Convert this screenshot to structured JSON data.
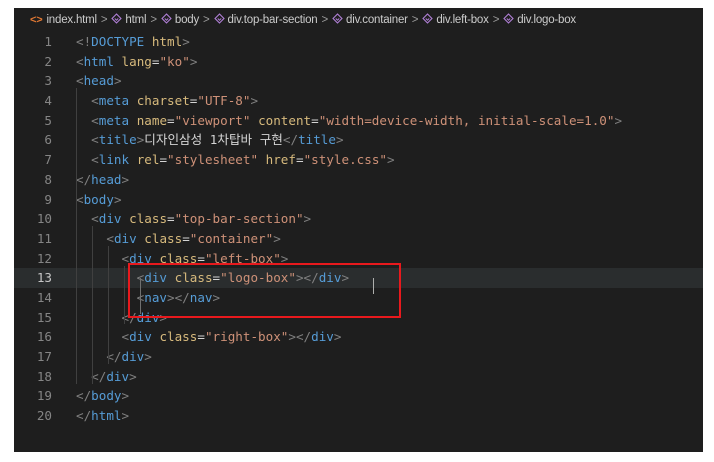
{
  "breadcrumb": {
    "items": [
      {
        "label": "index.html",
        "icon": "html-file-icon"
      },
      {
        "label": "html",
        "icon": "element-icon"
      },
      {
        "label": "body",
        "icon": "element-icon"
      },
      {
        "label": "div.top-bar-section",
        "icon": "element-icon"
      },
      {
        "label": "div.container",
        "icon": "element-icon"
      },
      {
        "label": "div.left-box",
        "icon": "element-icon"
      },
      {
        "label": "div.logo-box",
        "icon": "element-icon"
      }
    ],
    "separator": ">"
  },
  "code_lines": [
    {
      "n": "1",
      "parts": [
        [
          "t",
          "<!"
        ],
        [
          "tn",
          "DOCTYPE"
        ],
        [
          "tx",
          " "
        ],
        [
          "an",
          "html"
        ],
        [
          "t",
          ">"
        ]
      ]
    },
    {
      "n": "2",
      "parts": [
        [
          "t",
          "<"
        ],
        [
          "tn",
          "html"
        ],
        [
          "tx",
          " "
        ],
        [
          "an",
          "lang"
        ],
        [
          "tx",
          "="
        ],
        [
          "av",
          "\"ko\""
        ],
        [
          "t",
          ">"
        ]
      ]
    },
    {
      "n": "3",
      "parts": [
        [
          "t",
          "<"
        ],
        [
          "tn",
          "head"
        ],
        [
          "t",
          ">"
        ]
      ]
    },
    {
      "n": "4",
      "parts": [
        [
          "tx",
          "  "
        ],
        [
          "t",
          "<"
        ],
        [
          "tn",
          "meta"
        ],
        [
          "tx",
          " "
        ],
        [
          "an",
          "charset"
        ],
        [
          "tx",
          "="
        ],
        [
          "av",
          "\"UTF-8\""
        ],
        [
          "t",
          ">"
        ]
      ]
    },
    {
      "n": "5",
      "parts": [
        [
          "tx",
          "  "
        ],
        [
          "t",
          "<"
        ],
        [
          "tn",
          "meta"
        ],
        [
          "tx",
          " "
        ],
        [
          "an",
          "name"
        ],
        [
          "tx",
          "="
        ],
        [
          "av",
          "\"viewport\""
        ],
        [
          "tx",
          " "
        ],
        [
          "an",
          "content"
        ],
        [
          "tx",
          "="
        ],
        [
          "av",
          "\"width=device-width, initial-scale=1.0\""
        ],
        [
          "t",
          ">"
        ]
      ]
    },
    {
      "n": "6",
      "parts": [
        [
          "tx",
          "  "
        ],
        [
          "t",
          "<"
        ],
        [
          "tn",
          "title"
        ],
        [
          "t",
          ">"
        ],
        [
          "tx",
          "디자인삼성 1차탑바 구현"
        ],
        [
          "t",
          "</"
        ],
        [
          "tn",
          "title"
        ],
        [
          "t",
          ">"
        ]
      ]
    },
    {
      "n": "7",
      "parts": [
        [
          "tx",
          "  "
        ],
        [
          "t",
          "<"
        ],
        [
          "tn",
          "link"
        ],
        [
          "tx",
          " "
        ],
        [
          "an",
          "rel"
        ],
        [
          "tx",
          "="
        ],
        [
          "av",
          "\"stylesheet\""
        ],
        [
          "tx",
          " "
        ],
        [
          "an",
          "href"
        ],
        [
          "tx",
          "="
        ],
        [
          "av",
          "\"style.css\""
        ],
        [
          "t",
          ">"
        ]
      ]
    },
    {
      "n": "8",
      "parts": [
        [
          "t",
          "</"
        ],
        [
          "tn",
          "head"
        ],
        [
          "t",
          ">"
        ]
      ]
    },
    {
      "n": "9",
      "parts": [
        [
          "t",
          "<"
        ],
        [
          "tn",
          "body"
        ],
        [
          "t",
          ">"
        ]
      ]
    },
    {
      "n": "10",
      "parts": [
        [
          "tx",
          "  "
        ],
        [
          "t",
          "<"
        ],
        [
          "tn",
          "div"
        ],
        [
          "tx",
          " "
        ],
        [
          "an",
          "class"
        ],
        [
          "tx",
          "="
        ],
        [
          "av",
          "\"top-bar-section\""
        ],
        [
          "t",
          ">"
        ]
      ]
    },
    {
      "n": "11",
      "parts": [
        [
          "tx",
          "    "
        ],
        [
          "t",
          "<"
        ],
        [
          "tn",
          "div"
        ],
        [
          "tx",
          " "
        ],
        [
          "an",
          "class"
        ],
        [
          "tx",
          "="
        ],
        [
          "av",
          "\"container\""
        ],
        [
          "t",
          ">"
        ]
      ]
    },
    {
      "n": "12",
      "parts": [
        [
          "tx",
          "      "
        ],
        [
          "t",
          "<"
        ],
        [
          "tn",
          "div"
        ],
        [
          "tx",
          " "
        ],
        [
          "an",
          "class"
        ],
        [
          "tx",
          "="
        ],
        [
          "av",
          "\"left-box\""
        ],
        [
          "t",
          ">"
        ]
      ]
    },
    {
      "n": "13",
      "parts": [
        [
          "tx",
          "        "
        ],
        [
          "t",
          "<"
        ],
        [
          "tn",
          "div"
        ],
        [
          "tx",
          " "
        ],
        [
          "an",
          "class"
        ],
        [
          "tx",
          "="
        ],
        [
          "av",
          "\"logo-box\""
        ],
        [
          "t",
          "></"
        ],
        [
          "tn",
          "div"
        ],
        [
          "t",
          ">"
        ]
      ]
    },
    {
      "n": "14",
      "parts": [
        [
          "tx",
          "        "
        ],
        [
          "t",
          "<"
        ],
        [
          "tn",
          "nav"
        ],
        [
          "t",
          "></"
        ],
        [
          "tn",
          "nav"
        ],
        [
          "t",
          ">"
        ]
      ]
    },
    {
      "n": "15",
      "parts": [
        [
          "tx",
          "      "
        ],
        [
          "t",
          "</"
        ],
        [
          "tn",
          "div"
        ],
        [
          "t",
          ">"
        ]
      ]
    },
    {
      "n": "16",
      "parts": [
        [
          "tx",
          "      "
        ],
        [
          "t",
          "<"
        ],
        [
          "tn",
          "div"
        ],
        [
          "tx",
          " "
        ],
        [
          "an",
          "class"
        ],
        [
          "tx",
          "="
        ],
        [
          "av",
          "\"right-box\""
        ],
        [
          "t",
          "></"
        ],
        [
          "tn",
          "div"
        ],
        [
          "t",
          ">"
        ]
      ]
    },
    {
      "n": "17",
      "parts": [
        [
          "tx",
          "    "
        ],
        [
          "t",
          "</"
        ],
        [
          "tn",
          "div"
        ],
        [
          "t",
          ">"
        ]
      ]
    },
    {
      "n": "18",
      "parts": [
        [
          "tx",
          "  "
        ],
        [
          "t",
          "</"
        ],
        [
          "tn",
          "div"
        ],
        [
          "t",
          ">"
        ]
      ]
    },
    {
      "n": "19",
      "parts": [
        [
          "t",
          "</"
        ],
        [
          "tn",
          "body"
        ],
        [
          "t",
          ">"
        ]
      ]
    },
    {
      "n": "20",
      "parts": [
        [
          "t",
          "</"
        ],
        [
          "tn",
          "html"
        ],
        [
          "t",
          ">"
        ]
      ]
    }
  ],
  "active_line": "13",
  "colors": {
    "background": "#1e1e1e",
    "tag_bracket": "#808080",
    "tag_name": "#569cd6",
    "attr_name": "#d7ba7d",
    "attr_value": "#ce9178",
    "highlight_box": "#e8191d"
  }
}
